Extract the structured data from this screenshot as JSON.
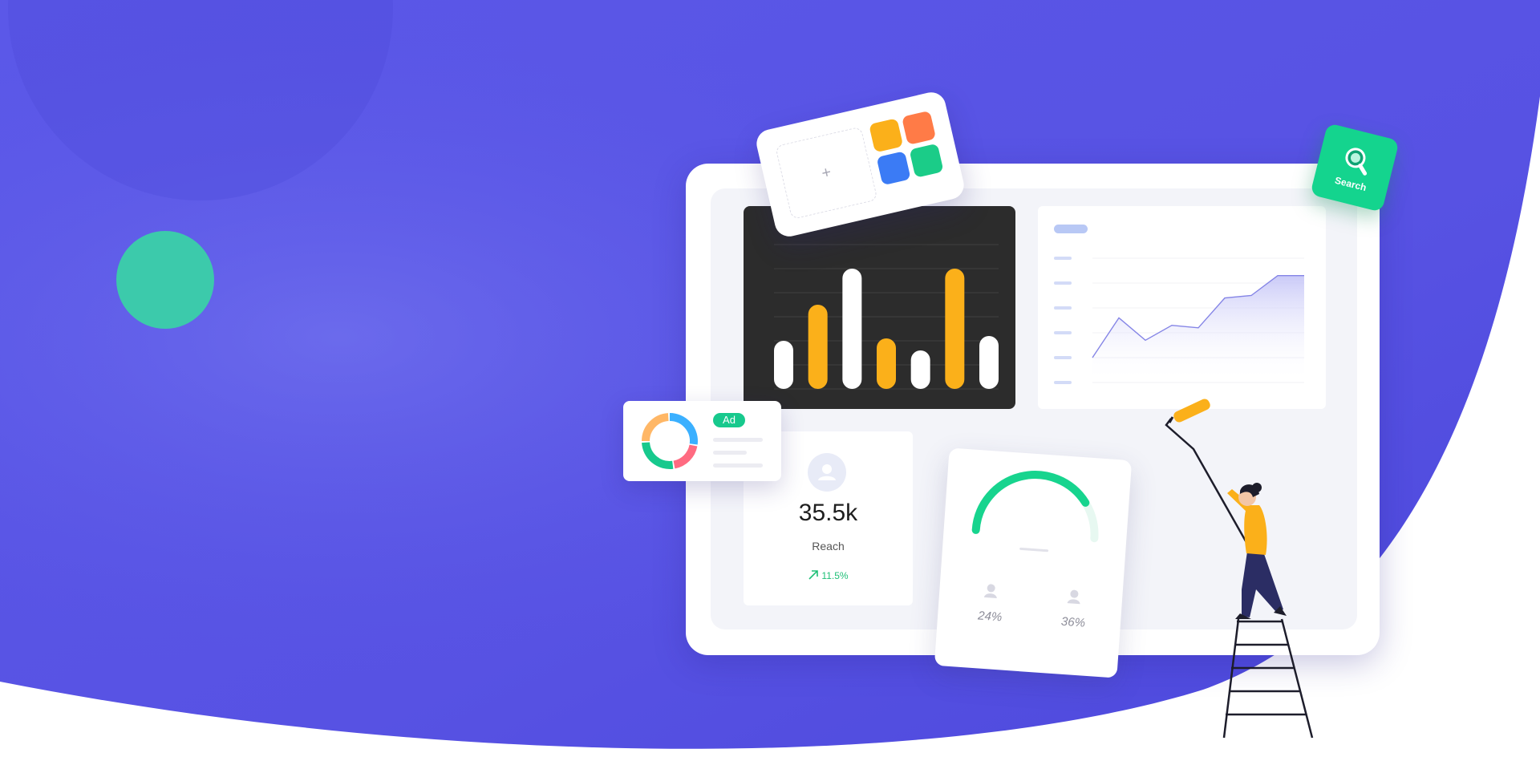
{
  "colors": {
    "background_purple": "#5451e2",
    "accent_green": "#14d48e",
    "accent_yellow": "#fbb01a",
    "accent_orange": "#ff7b47",
    "accent_blue": "#3b7bf5",
    "line_stroke": "#8585e6"
  },
  "apps_card": {
    "plus_glyph": "+",
    "tiles": [
      "#fbb01a",
      "#ff7b47",
      "#3b7bf5",
      "#1bcc88"
    ]
  },
  "reach_card": {
    "icon": "user-icon",
    "value": "35.5k",
    "label": "Reach",
    "change": "11.5%",
    "trend_icon": "arrow-up-right-icon"
  },
  "gauge_card": {
    "gauge_fraction": 0.8,
    "left_percent": "24%",
    "right_percent": "36%",
    "icon": "user-icon"
  },
  "ad_card": {
    "badge": "Ad",
    "donut_colors": [
      "#3bb0ff",
      "#ff6b81",
      "#17c98d",
      "#ffb766"
    ]
  },
  "search_card": {
    "label": "Search",
    "icon": "magnifier-icon"
  },
  "chart_data": [
    {
      "type": "bar",
      "values": [
        2,
        3.5,
        5,
        2.1,
        1.6,
        5,
        2.2
      ],
      "colors": [
        "#ffffff",
        "#fbb01a",
        "#ffffff",
        "#fbb01a",
        "#ffffff",
        "#fbb01a",
        "#ffffff"
      ],
      "ylim": [
        0,
        6
      ],
      "grid": true
    },
    {
      "type": "area",
      "values": [
        1,
        2.6,
        1.7,
        2.3,
        2.2,
        3.4,
        3.5,
        4.3,
        4.3
      ],
      "ylim": [
        0,
        5
      ],
      "grid": true
    }
  ]
}
